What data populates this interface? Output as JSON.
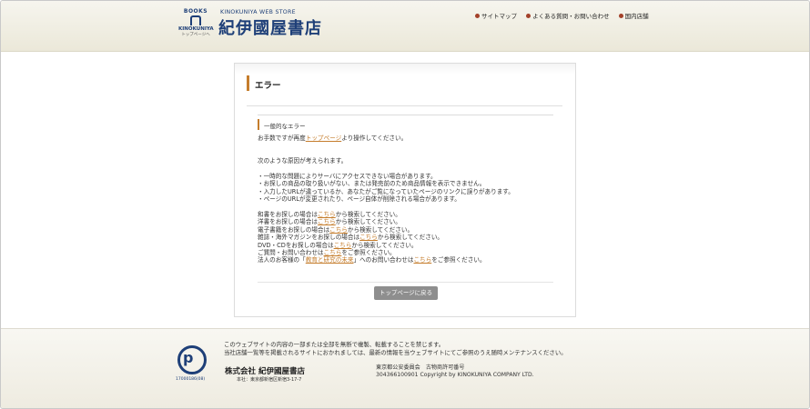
{
  "header": {
    "logo_books": "BOOKS",
    "logo_kinokuniya": "KINOKUNIYA",
    "logo_sub": "トップページへ",
    "store_en": "KINOKUNIYA WEB STORE",
    "store_jp": "紀伊國屋書店",
    "links": [
      "サイトマップ",
      "よくある質問・お問い合わせ",
      "国内店舗"
    ]
  },
  "panel": {
    "title": "エラー",
    "section_title": "一般的なエラー",
    "apology": {
      "before": "お手数ですが再度",
      "link": "トップページ",
      "after": "より操作してください。"
    },
    "reasons_heading": "次のような原因が考えられます。",
    "reasons": [
      "・一時的な問題によりサーバにアクセスできない場合があります。",
      "・お探しの商品の取り扱いがない、または発売前のため商品情報を表示できません。",
      "・入力したURLが違っているか、あなたがご覧になっていたページのリンクに誤りがあります。",
      "・ページのURLが変更されたり、ページ自体が削除される場合があります。"
    ],
    "search_lines": [
      {
        "before": "和書をお探しの場合は",
        "link": "こちら",
        "after": "から検索してください。"
      },
      {
        "before": "洋書をお探しの場合は",
        "link": "こちら",
        "after": "から検索してください。"
      },
      {
        "before": "電子書籍をお探しの場合は",
        "link": "こちら",
        "after": "から検索してください。"
      },
      {
        "before": "雑誌・海外マガジンをお探しの場合は",
        "link": "こちら",
        "after": "から検索してください。"
      },
      {
        "before": "DVD・CDをお探しの場合は",
        "link": "こちら",
        "after": "から検索してください。"
      },
      {
        "before": "ご質問・お問い合わせは",
        "link": "こちら",
        "after": "をご参照ください。"
      }
    ],
    "corporate_line": {
      "before": "法人のお客様の「",
      "link1": "教育と研究の未来",
      "middle": "」へのお問い合わせは",
      "link2": "こちら",
      "after": "をご参照ください。"
    },
    "button_label": "トップページに戻る"
  },
  "footer": {
    "privacy_number": "17000186(08)",
    "notice_1": "このウェブサイトの内容の一部または全部を無断で複製、転載することを禁じます。",
    "notice_2": "当社店舗一覧等を掲載されるサイトにおかれましては、最新の情報を当ウェブサイトにてご参照のうえ随時メンテナンスください。",
    "company": "株式会社 紀伊國屋書店",
    "address": "本社：東京都新宿区新宿3-17-7",
    "license_1": "東京都公安委員会　古物商許可番号",
    "license_2": "304366100901 Copyright by KINOKUNIYA COMPANY LTD."
  }
}
